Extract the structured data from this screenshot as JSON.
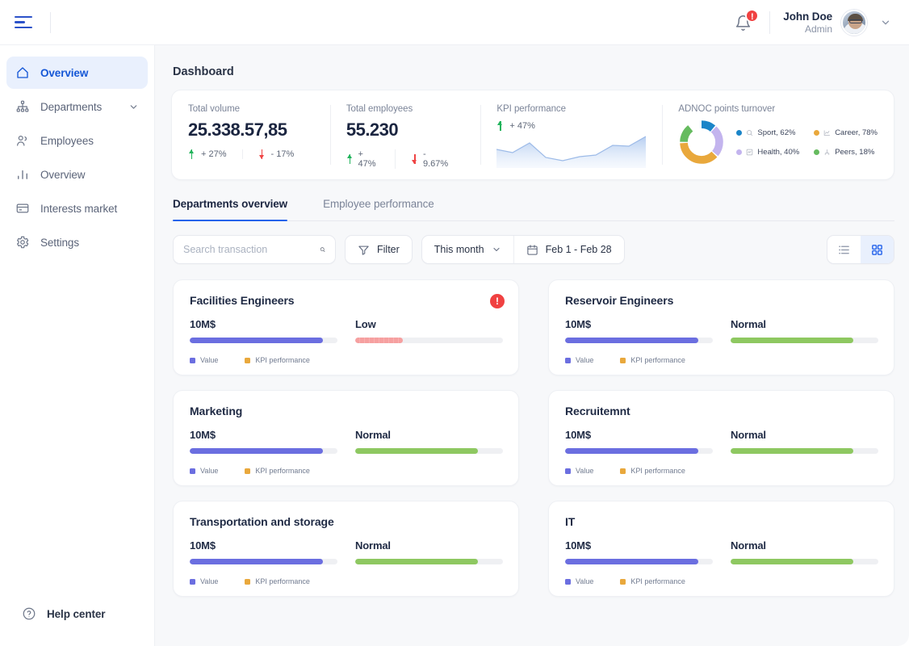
{
  "topbar": {
    "menu_icon": "hamburger-icon",
    "bell_icon": "bell-icon",
    "notification_count": "!",
    "user_name": "John Doe",
    "user_role": "Admin",
    "chevron_icon": "chevron-down-icon"
  },
  "sidebar": {
    "items": [
      {
        "label": "Overview",
        "icon": "home-icon",
        "active": true
      },
      {
        "label": "Departments",
        "icon": "org-chart-icon",
        "active": false,
        "chevron": true
      },
      {
        "label": "Employees",
        "icon": "users-icon",
        "active": false
      },
      {
        "label": "Overview",
        "icon": "bar-chart-icon",
        "active": false
      },
      {
        "label": "Interests market",
        "icon": "card-icon",
        "active": false
      },
      {
        "label": "Settings",
        "icon": "gear-icon",
        "active": false
      }
    ],
    "help": {
      "label": "Help center",
      "icon": "question-circle-icon"
    }
  },
  "page": {
    "title": "Dashboard"
  },
  "stats": {
    "total_volume": {
      "label": "Total volume",
      "value": "25.338.57,85",
      "deltas": [
        {
          "direction": "up",
          "text": "+ 27%"
        },
        {
          "direction": "down",
          "text": "- 17%"
        }
      ]
    },
    "total_employees": {
      "label": "Total employees",
      "value": "55.230",
      "deltas": [
        {
          "direction": "up",
          "text": "+ 47%"
        },
        {
          "direction": "down",
          "text": "- 9.67%"
        }
      ]
    },
    "kpi": {
      "label": "KPI performance",
      "delta": {
        "direction": "up",
        "text": "+ 47%"
      }
    },
    "adnoc": {
      "label": "ADNOC points turnover",
      "legend": [
        {
          "name": "Sport",
          "value": "62%",
          "text": "Sport, 62%",
          "color": "#1b85c8",
          "icon": "sport-icon"
        },
        {
          "name": "Career",
          "value": "78%",
          "text": "Career, 78%",
          "color": "#e9a83c",
          "icon": "chart-icon"
        },
        {
          "name": "Health",
          "value": "40%",
          "text": "Health, 40%",
          "color": "#c3b4ee",
          "icon": "health-icon"
        },
        {
          "name": "Peers",
          "value": "18%",
          "text": "Peers, 18%",
          "color": "#66bb5f",
          "icon": "peers-icon"
        }
      ]
    }
  },
  "chart_data": [
    {
      "type": "area",
      "title": "KPI performance",
      "x": [
        0,
        1,
        2,
        3,
        4,
        5,
        6,
        7,
        8,
        9
      ],
      "values": [
        52,
        44,
        70,
        30,
        22,
        32,
        36,
        60,
        58,
        82
      ],
      "ylim": [
        0,
        100
      ],
      "grid": false,
      "color": "#7ea6e8"
    },
    {
      "type": "pie",
      "title": "ADNOC points turnover",
      "categories": [
        "Sport",
        "Career",
        "Health",
        "Peers"
      ],
      "values": [
        62,
        78,
        40,
        18
      ],
      "slice_fractions": [
        0.12,
        0.38,
        0.25,
        0.15
      ],
      "colors": [
        "#1b85c8",
        "#e9a83c",
        "#c3b4ee",
        "#66bb5f"
      ],
      "legend": "right",
      "donut": true
    },
    {
      "type": "bar",
      "title": "Departments overview",
      "categories": [
        "Facilities Engineers",
        "Reservoir Engineers",
        "Marketing",
        "Recruitemnt",
        "Transportation and storage",
        "IT"
      ],
      "series": [
        {
          "name": "Value",
          "values": [
            90,
            90,
            90,
            90,
            90,
            90
          ],
          "labels": [
            "10M$",
            "10M$",
            "10M$",
            "10M$",
            "10M$",
            "10M$"
          ],
          "color": "#6b6ee0"
        },
        {
          "name": "KPI performance",
          "values": [
            32,
            83,
            83,
            83,
            83,
            83
          ],
          "labels": [
            "Low",
            "Normal",
            "Normal",
            "Normal",
            "Normal",
            "Normal"
          ],
          "colors": [
            "#f6a0a0",
            "#8ec861",
            "#8ec861",
            "#8ec861",
            "#8ec861",
            "#8ec861"
          ]
        }
      ],
      "ylim": [
        0,
        100
      ]
    }
  ],
  "tabs": [
    {
      "label": "Departments overview",
      "active": true
    },
    {
      "label": "Employee performance",
      "active": false
    }
  ],
  "toolbar": {
    "search_placeholder": "Search transaction",
    "search_value": "",
    "search_icon": "search-icon",
    "filter_label": "Filter",
    "filter_icon": "filter-icon",
    "period_label": "This month",
    "period_chevron": "chevron-down-icon",
    "date_range": "Feb 1 - Feb 28",
    "calendar_icon": "calendar-icon",
    "view_list_icon": "list-view-icon",
    "view_grid_icon": "grid-view-icon",
    "active_view": "grid"
  },
  "cards": [
    {
      "title": "Facilities Engineers",
      "alert": "!",
      "value_label": "10M$",
      "value_pct": 90,
      "kpi_label": "Low",
      "kpi_pct": 32,
      "kpi_state": "low",
      "legend": [
        {
          "label": "Value",
          "color": "#6b6ee0"
        },
        {
          "label": "KPI performance",
          "color": "#e9a83c"
        }
      ]
    },
    {
      "title": "Reservoir Engineers",
      "alert": null,
      "value_label": "10M$",
      "value_pct": 90,
      "kpi_label": "Normal",
      "kpi_pct": 83,
      "kpi_state": "normal",
      "legend": [
        {
          "label": "Value",
          "color": "#6b6ee0"
        },
        {
          "label": "KPI performance",
          "color": "#e9a83c"
        }
      ]
    },
    {
      "title": "Marketing",
      "alert": null,
      "value_label": "10M$",
      "value_pct": 90,
      "kpi_label": "Normal",
      "kpi_pct": 83,
      "kpi_state": "normal",
      "legend": [
        {
          "label": "Value",
          "color": "#6b6ee0"
        },
        {
          "label": "KPI performance",
          "color": "#e9a83c"
        }
      ]
    },
    {
      "title": "Recruitemnt",
      "alert": null,
      "value_label": "10M$",
      "value_pct": 90,
      "kpi_label": "Normal",
      "kpi_pct": 83,
      "kpi_state": "normal",
      "legend": [
        {
          "label": "Value",
          "color": "#6b6ee0"
        },
        {
          "label": "KPI performance",
          "color": "#e9a83c"
        }
      ]
    },
    {
      "title": "Transportation and storage",
      "alert": null,
      "value_label": "10M$",
      "value_pct": 90,
      "kpi_label": "Normal",
      "kpi_pct": 83,
      "kpi_state": "normal",
      "legend": [
        {
          "label": "Value",
          "color": "#6b6ee0"
        },
        {
          "label": "KPI performance",
          "color": "#e9a83c"
        }
      ]
    },
    {
      "title": "IT",
      "alert": null,
      "value_label": "10M$",
      "value_pct": 90,
      "kpi_label": "Normal",
      "kpi_pct": 83,
      "kpi_state": "normal",
      "legend": [
        {
          "label": "Value",
          "color": "#6b6ee0"
        },
        {
          "label": "KPI performance",
          "color": "#e9a83c"
        }
      ]
    }
  ]
}
